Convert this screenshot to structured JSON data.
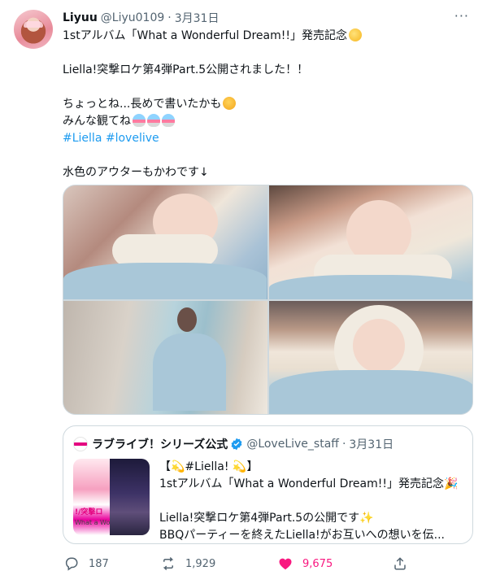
{
  "tweet": {
    "display_name": "Liyuu",
    "handle": "@Liyu0109",
    "separator": "·",
    "date": "3月31日",
    "more_label": "···",
    "text": {
      "line1": "1stアルバム「What a Wonderful Dream!!」発売記念",
      "line2": "Liella!突撃ロケ第4弾Part.5公開されました！！",
      "line3": "ちょっとね...長めで書いたかも",
      "line4": "みんな観てね",
      "hashtag1": "#Liella",
      "hashtag2": "#lovelive",
      "line6": "水色のアウターもかわです↓"
    },
    "emoji": {
      "line1": "dizzy-icon",
      "line3": "shushing-face-icon",
      "line4": "shaved-ice-icon"
    }
  },
  "media": {
    "photos": [
      "photo-1",
      "photo-2",
      "photo-3",
      "photo-4"
    ]
  },
  "quote": {
    "display_name": "ラブライブ！シリーズ公式",
    "verified": true,
    "handle": "@LoveLive_staff",
    "separator": "·",
    "date": "3月31日",
    "thumb_logo": "!/突撃ロ",
    "thumb_logo2": "What a Wo",
    "text": {
      "line1": "【💫#Liella! 💫】",
      "line2": "1stアルバム「What a Wonderful Dream!!」発売記念🎉",
      "line3": "Liella!突撃ロケ第4弾Part.5の公開です✨",
      "line4": "BBQパーティーを終えたLiella!がお互いへの想いを伝..."
    }
  },
  "actions": {
    "replies": "187",
    "retweets": "1,929",
    "likes": "9,675"
  },
  "colors": {
    "accent": "#1d9bf0",
    "like": "#f91880",
    "secondary_text": "#536471",
    "border": "#cfd9de"
  }
}
